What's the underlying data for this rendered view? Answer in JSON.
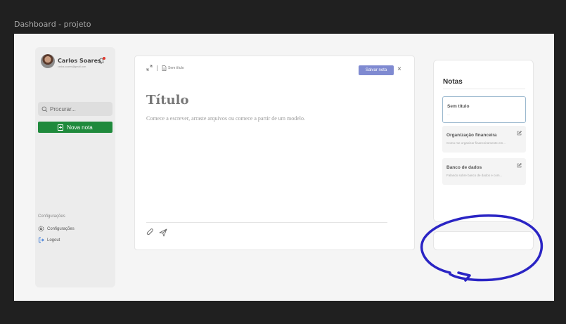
{
  "frame": {
    "label": "Dashboard - projeto"
  },
  "sidebar": {
    "user": {
      "name": "Carlos Soares",
      "email": "carlos.soares@gmail.com"
    },
    "search": {
      "placeholder": "Procurar..."
    },
    "new_note_label": "Nova nota",
    "config_heading": "Configurações",
    "links": [
      {
        "label": "Configurações",
        "icon": "gear-icon"
      },
      {
        "label": "Logout",
        "icon": "logout-icon"
      }
    ]
  },
  "editor": {
    "breadcrumb": "Sem título",
    "save_label": "Salvar nota",
    "close_label": "×",
    "title_placeholder": "Título",
    "body_placeholder": "Comece a escrever, arraste arquivos ou comece a partir de um modelo."
  },
  "notes": {
    "heading": "Notas",
    "items": [
      {
        "title": "Sem título",
        "preview": "...",
        "active": true
      },
      {
        "title": "Organização financeira",
        "preview": "Como me organizar financeiramente em..."
      },
      {
        "title": "Banco de dados",
        "preview": "Falando sobre banco de dados e com..."
      }
    ]
  },
  "colors": {
    "accent_green": "#1f8a3c",
    "save_button": "#7f8ad1",
    "annotation_ink": "#2a24c4",
    "notification_dot": "#e0382e"
  }
}
